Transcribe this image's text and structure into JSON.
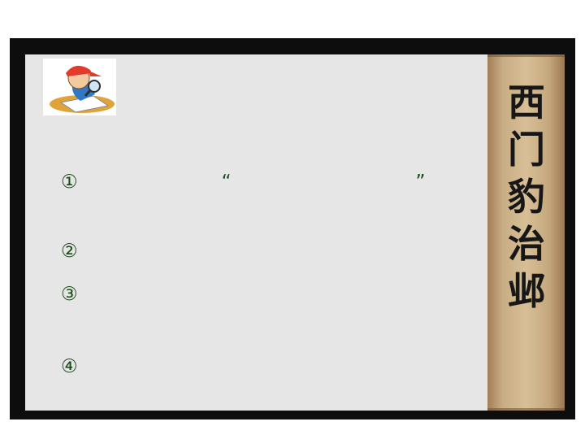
{
  "question": "　　　　　　　　　　　　　　　　　　",
  "items": [
    "①　　　　　　　“　　　　　　　　　”　　　　　　",
    "②　　　　　　　　　　　",
    "③　　　　　　　　　　　　　　　　　　　　　　",
    "④　　　　　　　　　　　　　　　　　　"
  ],
  "scroll_title": [
    "西",
    "门",
    "豹",
    "治",
    "邺"
  ],
  "colors": {
    "question": "#8b1a1a",
    "items": "#1a4a1a",
    "panel": "#e6e6e6",
    "frame": "#0d0d0d"
  }
}
